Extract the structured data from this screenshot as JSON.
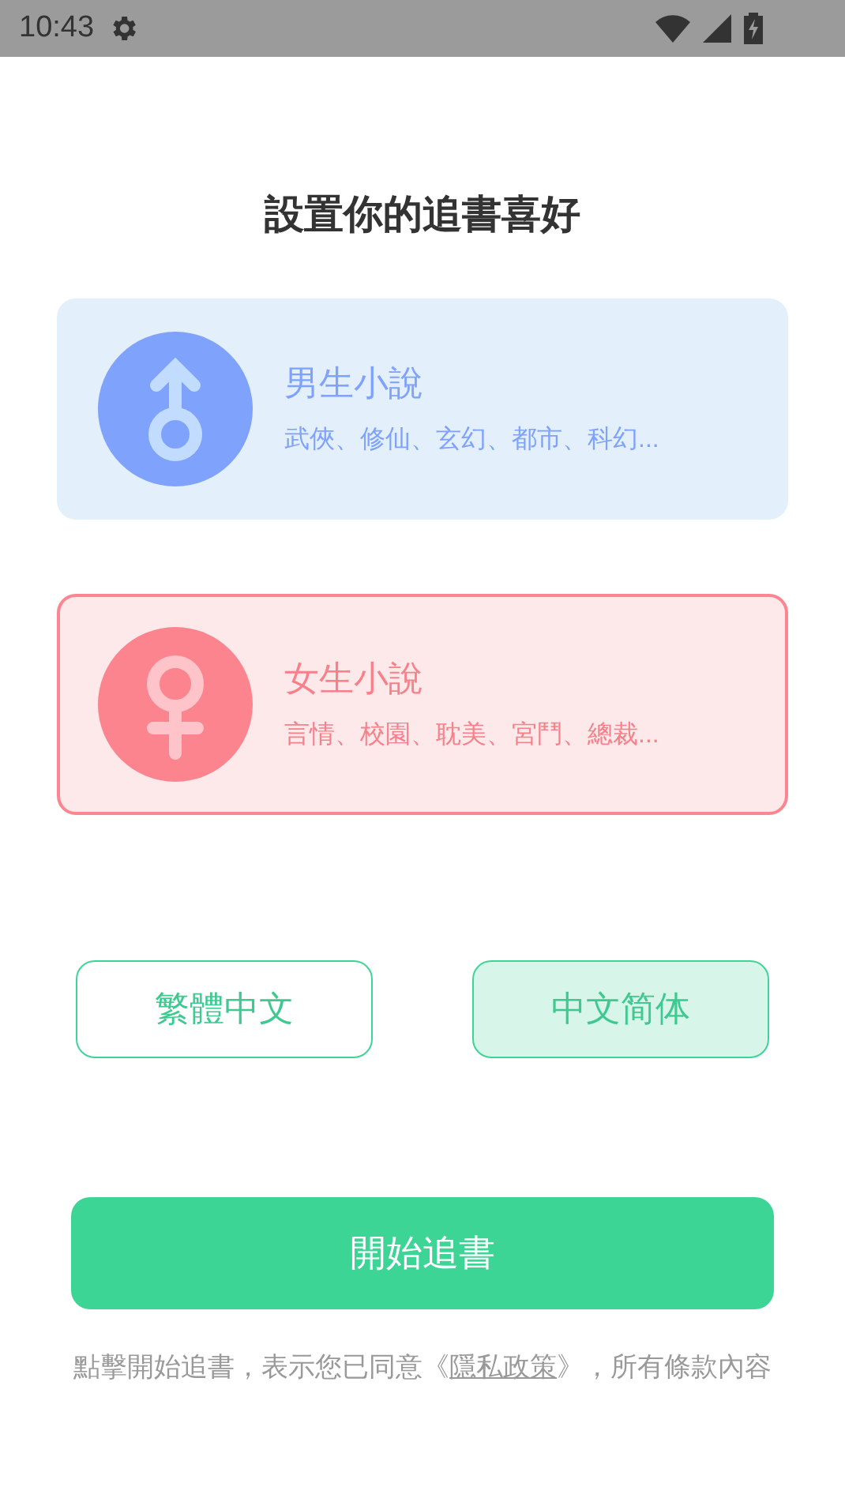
{
  "status_bar": {
    "time": "10:43"
  },
  "title": "設置你的追書喜好",
  "categories": [
    {
      "kind": "male",
      "title": "男生小說",
      "subtitle": "武俠、修仙、玄幻、都市、科幻...",
      "selected": false
    },
    {
      "kind": "female",
      "title": "女生小說",
      "subtitle": "言情、校園、耽美、宮鬥、總裁...",
      "selected": true
    }
  ],
  "languages": [
    {
      "label": "繁體中文",
      "selected": false
    },
    {
      "label": "中文简体",
      "selected": true
    }
  ],
  "start_button": "開始追書",
  "agreement": {
    "before": "點擊開始追書，表示您已同意《",
    "link": "隱私政策",
    "after": "》，所有條款內容"
  }
}
